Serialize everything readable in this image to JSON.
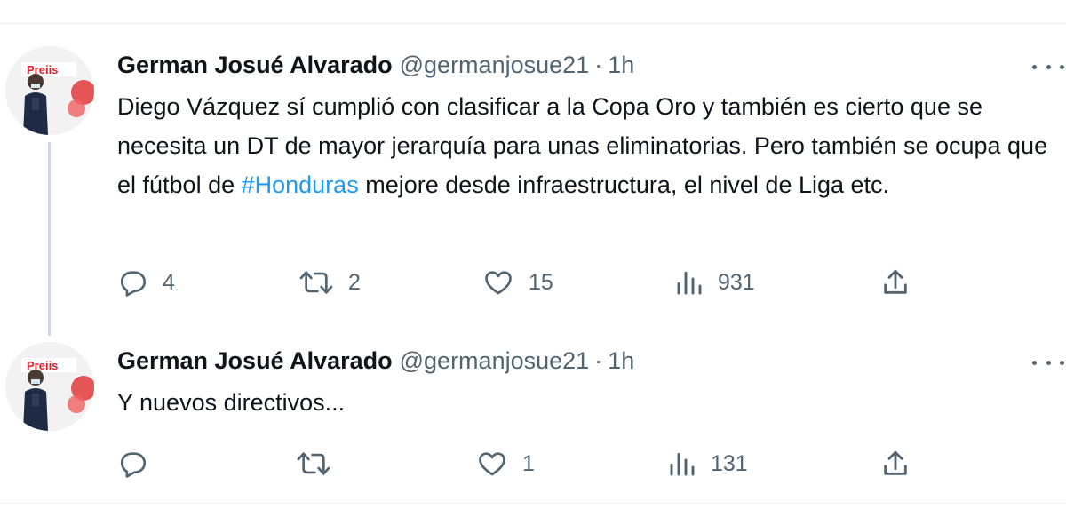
{
  "tweets": [
    {
      "author_name": "German Josué Alvarado",
      "author_handle": "@germanjosue21",
      "separator": "·",
      "time": "1h",
      "text_before": "Diego Vázquez sí cumplió con clasificar a la Copa Oro y también es cierto que se necesita un DT de mayor jerarquía para unas eliminatorias. Pero también se ocupa que el fútbol de ",
      "hashtag": "#Honduras",
      "text_after": " mejore desde infraestructura, el nivel de Liga etc.",
      "reply_count": "4",
      "retweet_count": "2",
      "like_count": "15",
      "view_count": "931"
    },
    {
      "author_name": "German Josué Alvarado",
      "author_handle": "@germanjosue21",
      "separator": "·",
      "time": "1h",
      "text": "Y nuevos directivos...",
      "reply_count": "",
      "retweet_count": "",
      "like_count": "1",
      "view_count": "131"
    }
  ],
  "icons": {
    "reply": "reply-icon",
    "retweet": "retweet-icon",
    "like": "like-icon",
    "views": "views-icon",
    "share": "share-icon",
    "more": "more-icon"
  },
  "colors": {
    "hashtag": "#1d9bf0",
    "secondary_text": "#536471",
    "primary_text": "#0f1419",
    "thread_line": "#cfd9de",
    "avatar_logo_red": "#e0202a"
  }
}
